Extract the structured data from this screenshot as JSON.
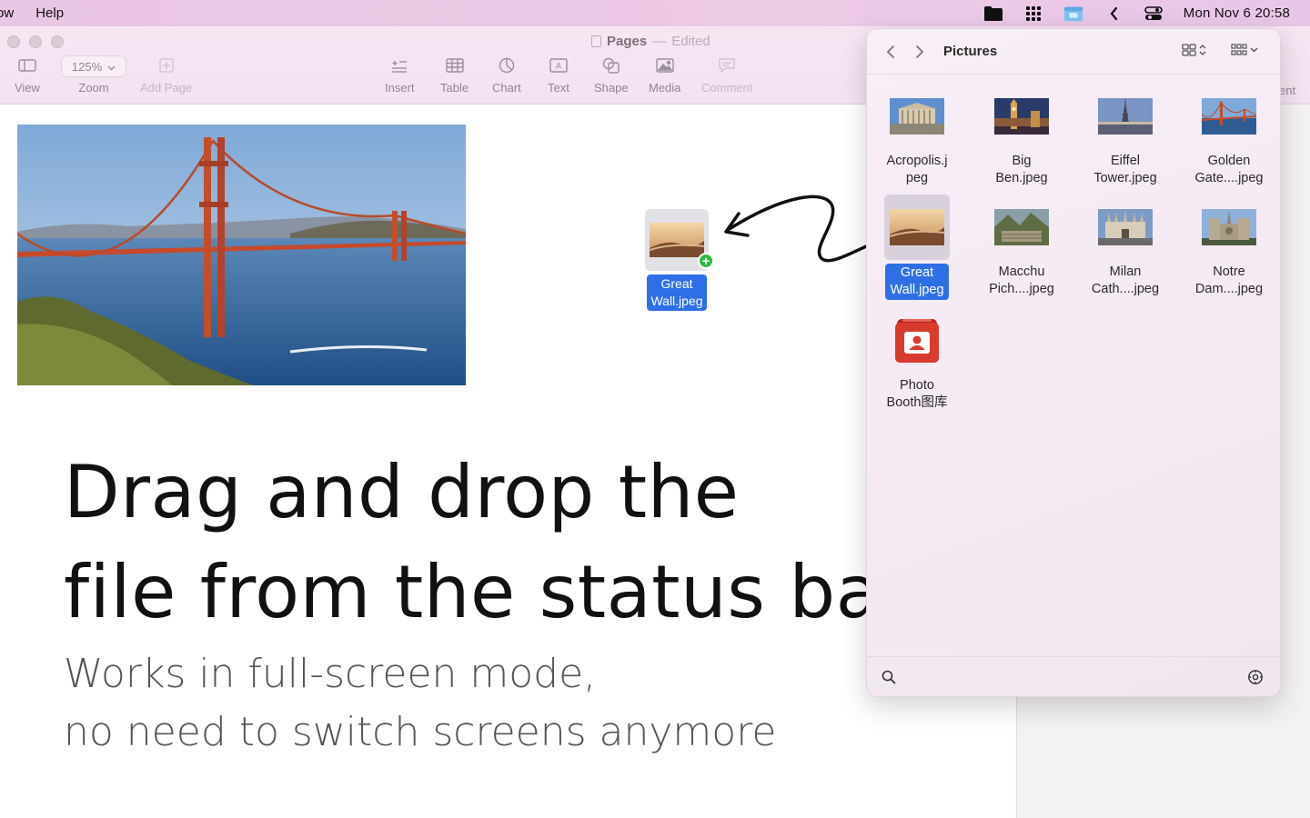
{
  "menubar": {
    "left_items": [
      "ow",
      "Help"
    ],
    "clock": "Mon Nov 6  20:58",
    "icons": [
      "folder-icon",
      "grid-apps-icon",
      "finder-window-icon",
      "chevron-left-icon",
      "control-center-icon"
    ]
  },
  "pages": {
    "title": "Pages",
    "separator": "—",
    "status": "Edited",
    "toolbar": {
      "view": "View",
      "zoom_value": "125%",
      "zoom": "Zoom",
      "add_page": "Add Page",
      "insert": "Insert",
      "table": "Table",
      "chart": "Chart",
      "text": "Text",
      "shape": "Shape",
      "media": "Media",
      "comment": "Comment",
      "right_partial": "ent"
    },
    "document": {
      "headline_line1": "Drag and drop the",
      "headline_line2": "file from the status bar",
      "sub_line1": "Works in full-screen mode,",
      "sub_line2": "no need to switch screens anymore"
    },
    "drag_ghost": {
      "label": "Great\nWall.jpeg",
      "badge": "+"
    }
  },
  "finder_popover": {
    "title": "Pictures",
    "files": [
      {
        "name": "Acropolis.j\npeg",
        "selected": false
      },
      {
        "name": "Big\nBen.jpeg",
        "selected": false
      },
      {
        "name": "Eiffel\nTower.jpeg",
        "selected": false
      },
      {
        "name": "Golden\nGate....jpeg",
        "selected": false
      },
      {
        "name": "Great\nWall.jpeg",
        "selected": true
      },
      {
        "name": "Macchu\nPich....jpeg",
        "selected": false
      },
      {
        "name": "Milan\nCath....jpeg",
        "selected": false
      },
      {
        "name": "Notre\nDam....jpeg",
        "selected": false
      },
      {
        "name": "Photo\nBooth图库",
        "selected": false
      }
    ]
  },
  "colors": {
    "menubar": "#ecc9e5",
    "selection": "#2f6fe6",
    "badge_green": "#2fb944"
  }
}
